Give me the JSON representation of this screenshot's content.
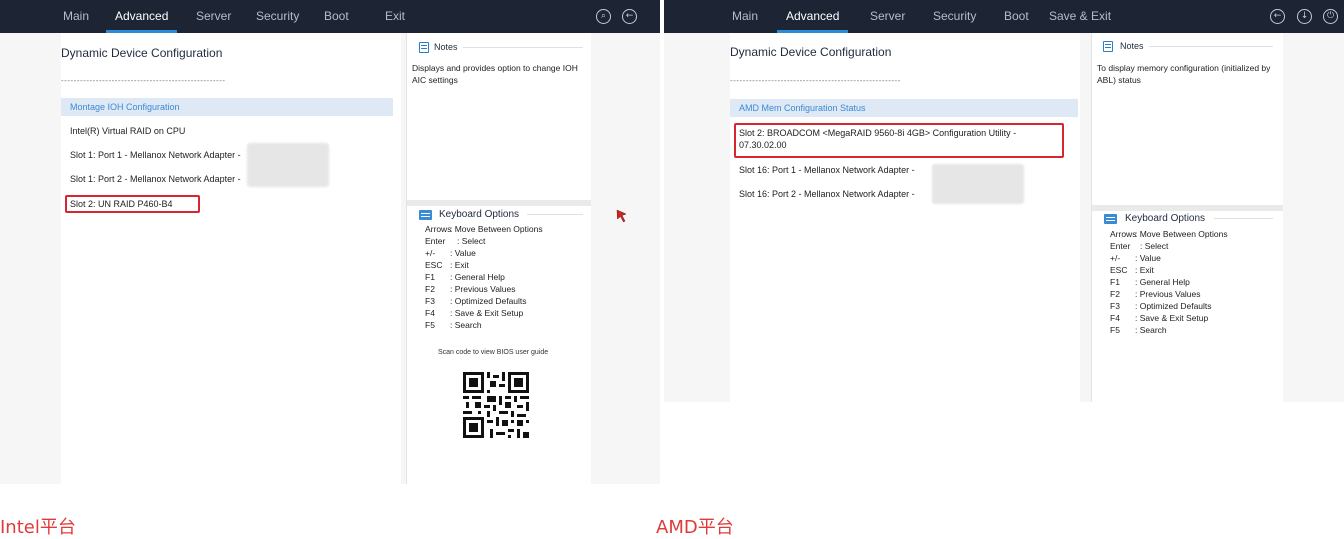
{
  "intel": {
    "tabs": [
      "Main",
      "Advanced",
      "Server",
      "Security",
      "Boot",
      "Exit"
    ],
    "active_tab": "Advanced",
    "top_icons": [
      "search-icon",
      "back-icon"
    ],
    "page_title": "Dynamic Device Configuration",
    "separator": "------------------------------------------------------",
    "highlighted_item": "Montage IOH Configuration",
    "items": [
      "Intel(R) Virtual RAID on CPU",
      "Slot 1: Port 1 - Mellanox Network Adapter -",
      "Slot 1: Port 2 - Mellanox Network Adapter -",
      "Slot 2: UN RAID P460-B4"
    ],
    "boxed_item": "Slot 2: UN RAID P460-B4",
    "notes": {
      "title": "Notes",
      "text": "Displays and provides option to change IOH AIC settings"
    },
    "keyboard": {
      "title": "Keyboard Options",
      "rows": [
        {
          "key": "Arrows",
          "desc": ": Move Between Options"
        },
        {
          "key": "Enter",
          "desc": ": Select"
        },
        {
          "key": "+/-",
          "desc": ": Value"
        },
        {
          "key": "ESC",
          "desc": ": Exit"
        },
        {
          "key": "F1",
          "desc": ": General Help"
        },
        {
          "key": "F2",
          "desc": ": Previous Values"
        },
        {
          "key": "F3",
          "desc": ": Optimized Defaults"
        },
        {
          "key": "F4",
          "desc": ": Save & Exit Setup"
        },
        {
          "key": "F5",
          "desc": ": Search"
        }
      ]
    },
    "scan_text": "Scan code to view BIOS user guide"
  },
  "amd": {
    "tabs": [
      "Main",
      "Advanced",
      "Server",
      "Security",
      "Boot",
      "Save & Exit"
    ],
    "active_tab": "Advanced",
    "top_icons": [
      "back-icon",
      "download-icon",
      "power-icon"
    ],
    "page_title": "Dynamic Device Configuration",
    "separator": "------------------------------------------------------",
    "highlighted_item": "AMD Mem Configuration Status",
    "boxed_item_line1": "Slot 2: BROADCOM <MegaRAID 9560-8i 4GB> Configuration Utility -",
    "boxed_item_line2": "07.30.02.00",
    "items": [
      "Slot 16: Port 1 - Mellanox Network Adapter -",
      "Slot 16: Port 2 - Mellanox Network Adapter -"
    ],
    "notes": {
      "title": "Notes",
      "text": "To display memory configuration (initialized by ABL) status"
    },
    "keyboard": {
      "title": "Keyboard Options",
      "rows": [
        {
          "key": "Arrows",
          "desc": ": Move Between Options"
        },
        {
          "key": "Enter",
          "desc": ": Select"
        },
        {
          "key": "+/-",
          "desc": ": Value"
        },
        {
          "key": "ESC",
          "desc": ": Exit"
        },
        {
          "key": "F1",
          "desc": ": General Help"
        },
        {
          "key": "F2",
          "desc": ": Previous Values"
        },
        {
          "key": "F3",
          "desc": ": Optimized Defaults"
        },
        {
          "key": "F4",
          "desc": ": Save & Exit Setup"
        },
        {
          "key": "F5",
          "desc": ": Search"
        }
      ]
    }
  },
  "captions": {
    "left": "Intel平台",
    "right": "AMD平台"
  },
  "colors": {
    "topbar": "#1d2434",
    "accent": "#2a8bd8",
    "highlight": "#3b8ad4",
    "callout": "#d7262f",
    "caption": "#e03b3b"
  }
}
